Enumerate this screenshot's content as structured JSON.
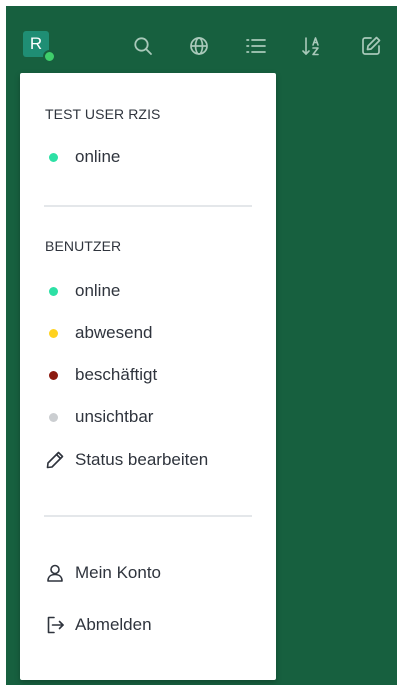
{
  "topbar": {
    "avatar_initial": "R",
    "avatar_color": "#1f8e74",
    "avatar_status_color": "#3fce6b",
    "background": "#17603f",
    "icons": [
      "search-icon",
      "globe-icon",
      "list-icon",
      "sort-alpha-icon",
      "edit-icon"
    ]
  },
  "menu": {
    "user_section": {
      "title": "TEST USER RZIS",
      "status_label": "online",
      "status_color": "#2de0a5"
    },
    "status_section": {
      "title": "BENUTZER",
      "items": [
        {
          "label": "online",
          "color": "#2de0a5"
        },
        {
          "label": "abwesend",
          "color": "#ffd21f"
        },
        {
          "label": "beschäftigt",
          "color": "#8c1a10"
        },
        {
          "label": "unsichtbar",
          "color": "#cbced1"
        }
      ],
      "edit_label": "Status bearbeiten"
    },
    "account_section": {
      "my_account_label": "Mein Konto",
      "logout_label": "Abmelden"
    }
  }
}
